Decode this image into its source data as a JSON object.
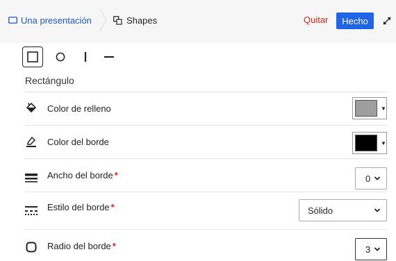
{
  "breadcrumb": {
    "presentation_label": "Una presentación",
    "current_label": "Shapes"
  },
  "toolbar": {
    "quit_label": "Quitar",
    "done_label": "Hecho"
  },
  "shape_picker": {
    "shapes": [
      "rectangle",
      "circle",
      "vertical-line",
      "horizontal-line"
    ],
    "selected": "rectangle",
    "selected_label": "Rectángulo"
  },
  "properties": {
    "fill": {
      "label": "Color de relleno",
      "color": "#9e9e9e"
    },
    "border_color": {
      "label": "Color del borde",
      "color": "#000000"
    },
    "border_width": {
      "label": "Ancho del borde",
      "required_mark": "*",
      "value": "0"
    },
    "border_style": {
      "label": "Estilo del borde",
      "required_mark": "*",
      "value": "Sólido"
    },
    "border_radius": {
      "label": "Radio del borde",
      "required_mark": "*",
      "value": "3"
    }
  },
  "colors": {
    "accent": "#2064e8",
    "link": "#1a57c9",
    "danger": "#d9261c"
  }
}
